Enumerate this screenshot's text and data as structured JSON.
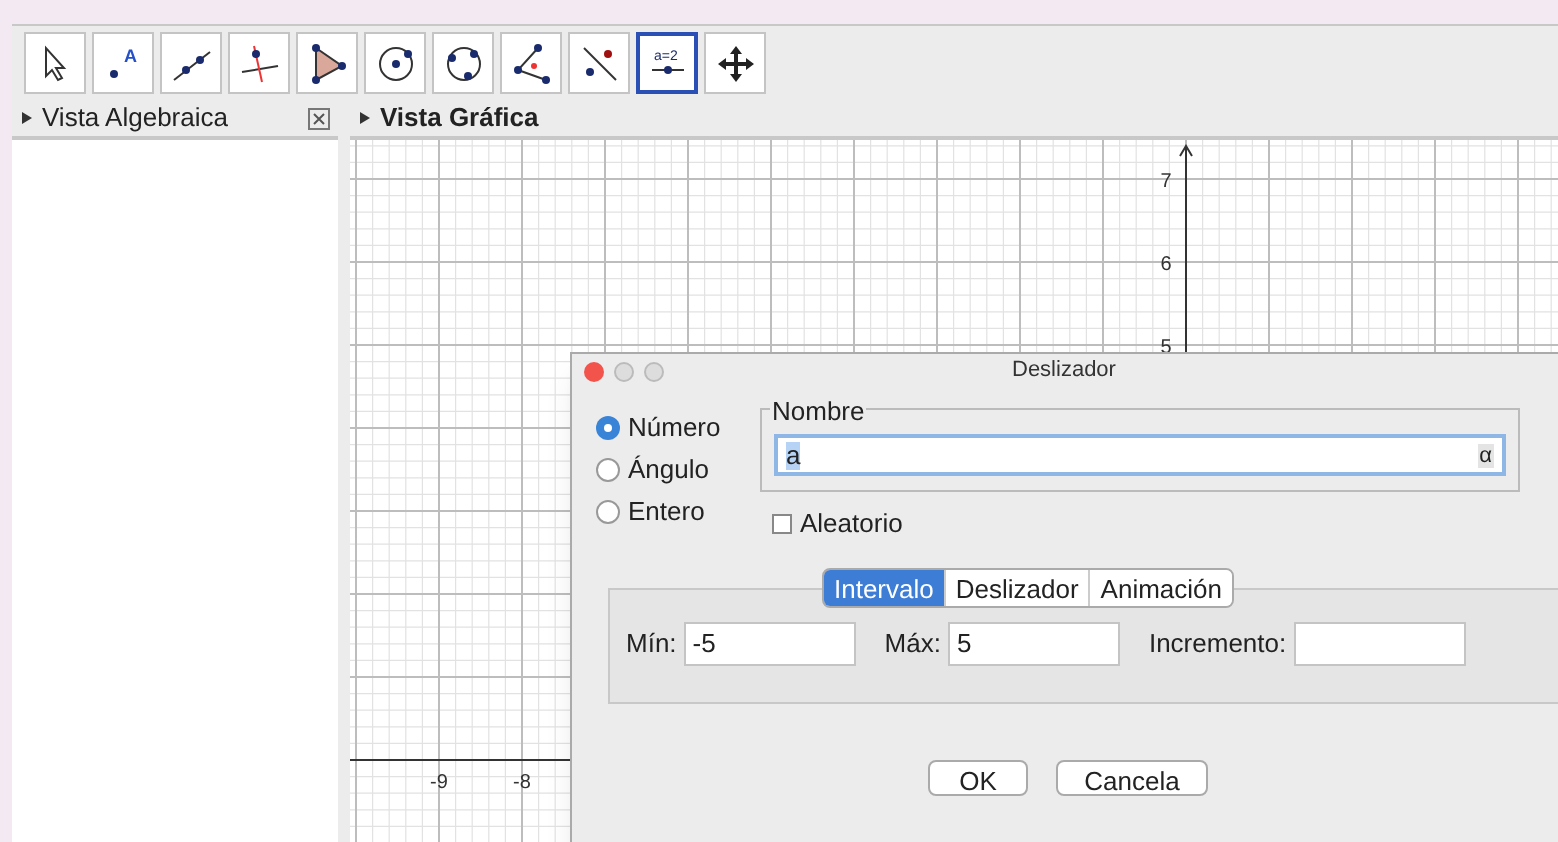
{
  "toolbar": {
    "tools": [
      {
        "selected": false
      },
      {
        "selected": false,
        "icon_text": "A"
      },
      {
        "selected": false
      },
      {
        "selected": false
      },
      {
        "selected": false
      },
      {
        "selected": false
      },
      {
        "selected": false
      },
      {
        "selected": false
      },
      {
        "selected": false
      },
      {
        "selected": true,
        "icon_text": "a=2"
      },
      {
        "selected": false
      }
    ]
  },
  "algebra_view": {
    "title": "Vista Algebraica"
  },
  "graphics_view": {
    "title": "Vista Gráfica",
    "y_ticks": [
      "7",
      "6",
      "5"
    ],
    "x_ticks": [
      "-9",
      "-8"
    ]
  },
  "dialog": {
    "title": "Deslizador",
    "types": [
      {
        "label": "Número",
        "selected": true
      },
      {
        "label": "Ángulo",
        "selected": false
      },
      {
        "label": "Entero",
        "selected": false
      }
    ],
    "name_label": "Nombre",
    "name_value": "a",
    "symbol_button": "α",
    "random": {
      "label": "Aleatorio",
      "checked": false
    },
    "tabs": [
      {
        "label": "Intervalo",
        "selected": true
      },
      {
        "label": "Deslizador",
        "selected": false
      },
      {
        "label": "Animación",
        "selected": false
      }
    ],
    "fields": [
      {
        "label": "Mín:",
        "value": "-5"
      },
      {
        "label": "Máx:",
        "value": "5"
      },
      {
        "label": "Incremento:"
      }
    ],
    "buttons": [
      "OK",
      "Cancela"
    ]
  }
}
